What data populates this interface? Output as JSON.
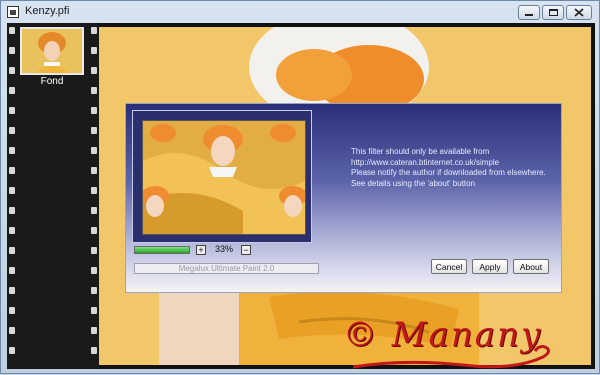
{
  "window": {
    "title": "Kenzy.pfi"
  },
  "filmstrip": {
    "items": [
      {
        "label": "Fond"
      }
    ]
  },
  "dialog": {
    "zoom": {
      "level_text": "33%",
      "plus_label": "+",
      "minus_label": "−",
      "bar_fraction": 1.0
    },
    "plugin_name": "Megalux Ultimate Paint 2.0",
    "info_lines": [
      "This filter should only be available from",
      "http://www.cateran.btinternet.co.uk/simple",
      "Please notify the author if downloaded from elsewhere.",
      "See details using the 'about' button"
    ],
    "buttons": {
      "cancel": "Cancel",
      "apply": "Apply",
      "about": "About"
    }
  },
  "watermark": {
    "text": "© Manany"
  },
  "colors": {
    "canvas": "#f1c76a",
    "dialog_top": "#2a2f7a",
    "accent_green": "#2aa52a",
    "signature": "#c0181a"
  }
}
